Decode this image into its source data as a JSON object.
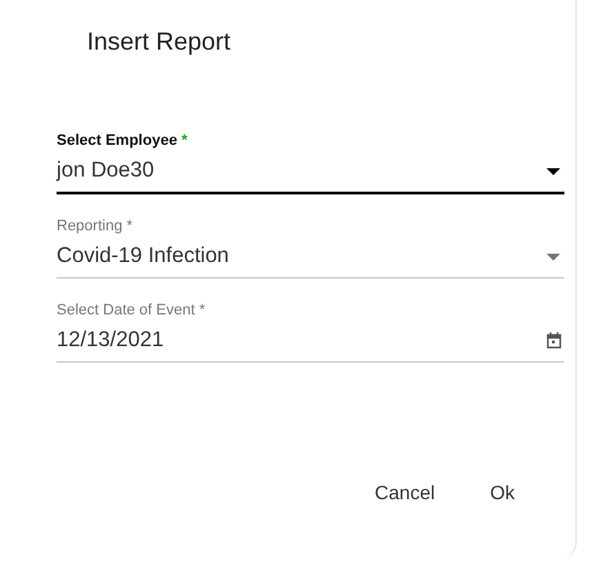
{
  "dialog": {
    "title": "Insert Report"
  },
  "fields": [
    {
      "kind": "select",
      "label": "Select Employee",
      "required_mark": "*",
      "value": "jon Doe30",
      "focused": true
    },
    {
      "kind": "select",
      "label": "Reporting",
      "required_mark": "*",
      "value": "Covid-19 Infection",
      "focused": false
    },
    {
      "kind": "date",
      "label": "Select Date of Event",
      "required_mark": "*",
      "value": "12/13/2021",
      "focused": false
    }
  ],
  "buttons": [
    {
      "label": "Cancel"
    },
    {
      "label": "Ok"
    }
  ]
}
